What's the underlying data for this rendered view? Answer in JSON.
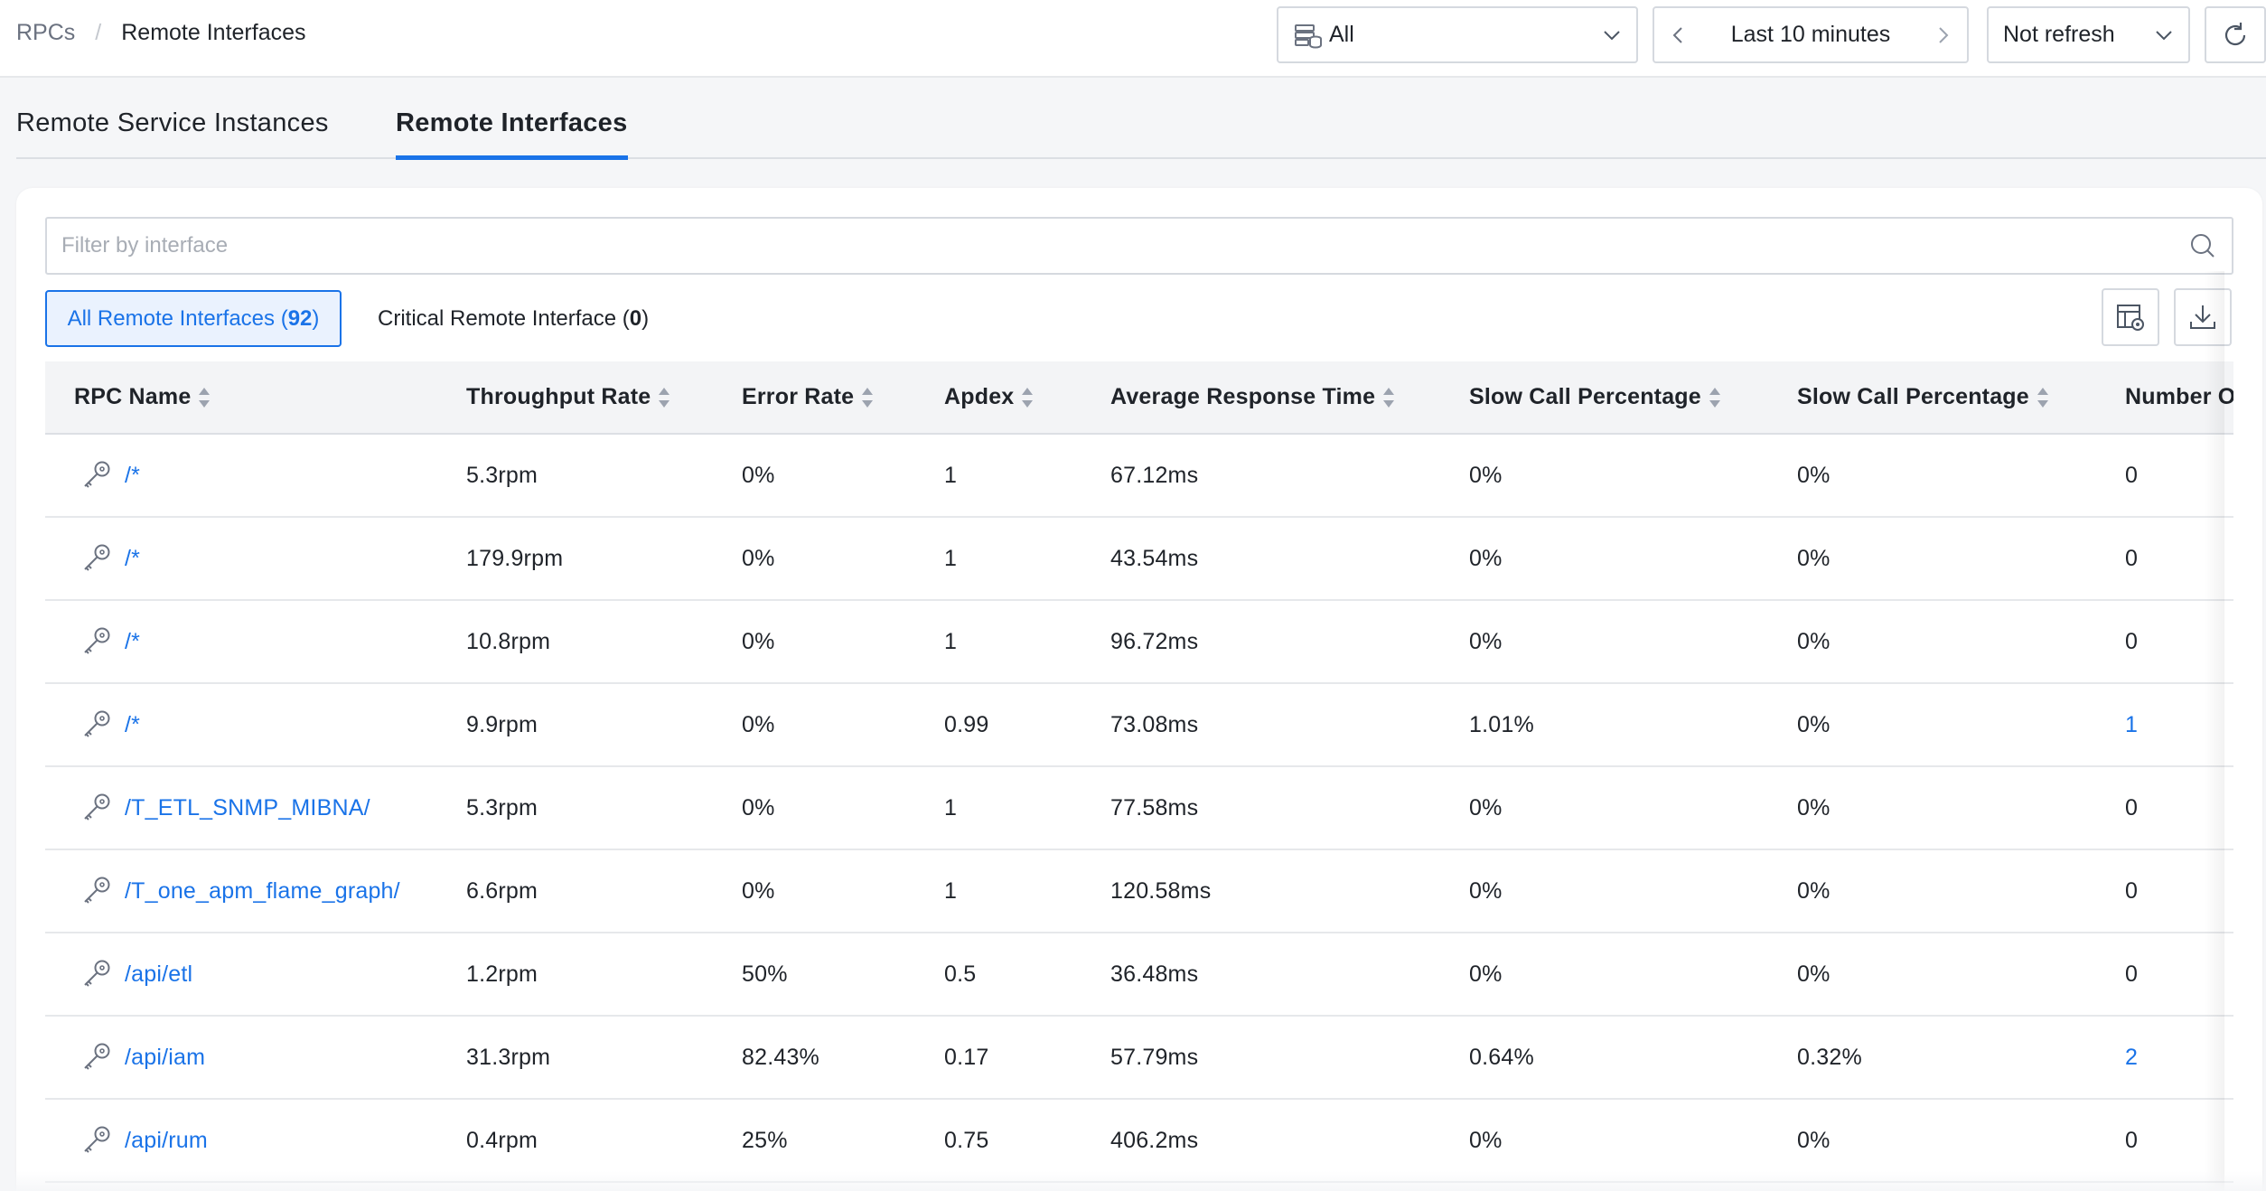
{
  "breadcrumb": {
    "root": "RPCs",
    "separator": "/",
    "current": "Remote Interfaces"
  },
  "controls": {
    "environment": "All",
    "time_range": "Last 10 minutes",
    "refresh": "Not refresh"
  },
  "tabs": [
    {
      "label": "Remote Service Instances",
      "active": false
    },
    {
      "label": "Remote Interfaces",
      "active": true
    }
  ],
  "filter": {
    "placeholder": "Filter by interface",
    "value": ""
  },
  "segments": {
    "all_label": "All Remote Interfaces (",
    "all_count": "92",
    "critical_label": "Critical Remote Interface (",
    "critical_count": "0",
    "close": ")"
  },
  "table": {
    "columns": [
      "RPC Name",
      "Throughput Rate",
      "Error Rate",
      "Apdex",
      "Average Response Time",
      "Slow Call Percentage",
      "Slow Call Percentage",
      "Number Of Slow Calls"
    ],
    "rows": [
      {
        "name": "/*",
        "throughput": "5.3rpm",
        "error": "0%",
        "apdex": "1",
        "avg": "67.12ms",
        "slow1": "0%",
        "slow2": "0%",
        "count": "0"
      },
      {
        "name": "/*",
        "throughput": "179.9rpm",
        "error": "0%",
        "apdex": "1",
        "avg": "43.54ms",
        "slow1": "0%",
        "slow2": "0%",
        "count": "0"
      },
      {
        "name": "/*",
        "throughput": "10.8rpm",
        "error": "0%",
        "apdex": "1",
        "avg": "96.72ms",
        "slow1": "0%",
        "slow2": "0%",
        "count": "0"
      },
      {
        "name": "/*",
        "throughput": "9.9rpm",
        "error": "0%",
        "apdex": "0.99",
        "avg": "73.08ms",
        "slow1": "1.01%",
        "slow2": "0%",
        "count": "1"
      },
      {
        "name": "/T_ETL_SNMP_MIBNA/",
        "throughput": "5.3rpm",
        "error": "0%",
        "apdex": "1",
        "avg": "77.58ms",
        "slow1": "0%",
        "slow2": "0%",
        "count": "0"
      },
      {
        "name": "/T_one_apm_flame_graph/",
        "throughput": "6.6rpm",
        "error": "0%",
        "apdex": "1",
        "avg": "120.58ms",
        "slow1": "0%",
        "slow2": "0%",
        "count": "0"
      },
      {
        "name": "/api/etl",
        "throughput": "1.2rpm",
        "error": "50%",
        "apdex": "0.5",
        "avg": "36.48ms",
        "slow1": "0%",
        "slow2": "0%",
        "count": "0"
      },
      {
        "name": "/api/iam",
        "throughput": "31.3rpm",
        "error": "82.43%",
        "apdex": "0.17",
        "avg": "57.79ms",
        "slow1": "0.64%",
        "slow2": "0.32%",
        "count": "2"
      },
      {
        "name": "/api/rum",
        "throughput": "0.4rpm",
        "error": "25%",
        "apdex": "0.75",
        "avg": "406.2ms",
        "slow1": "0%",
        "slow2": "0%",
        "count": "0"
      }
    ]
  }
}
